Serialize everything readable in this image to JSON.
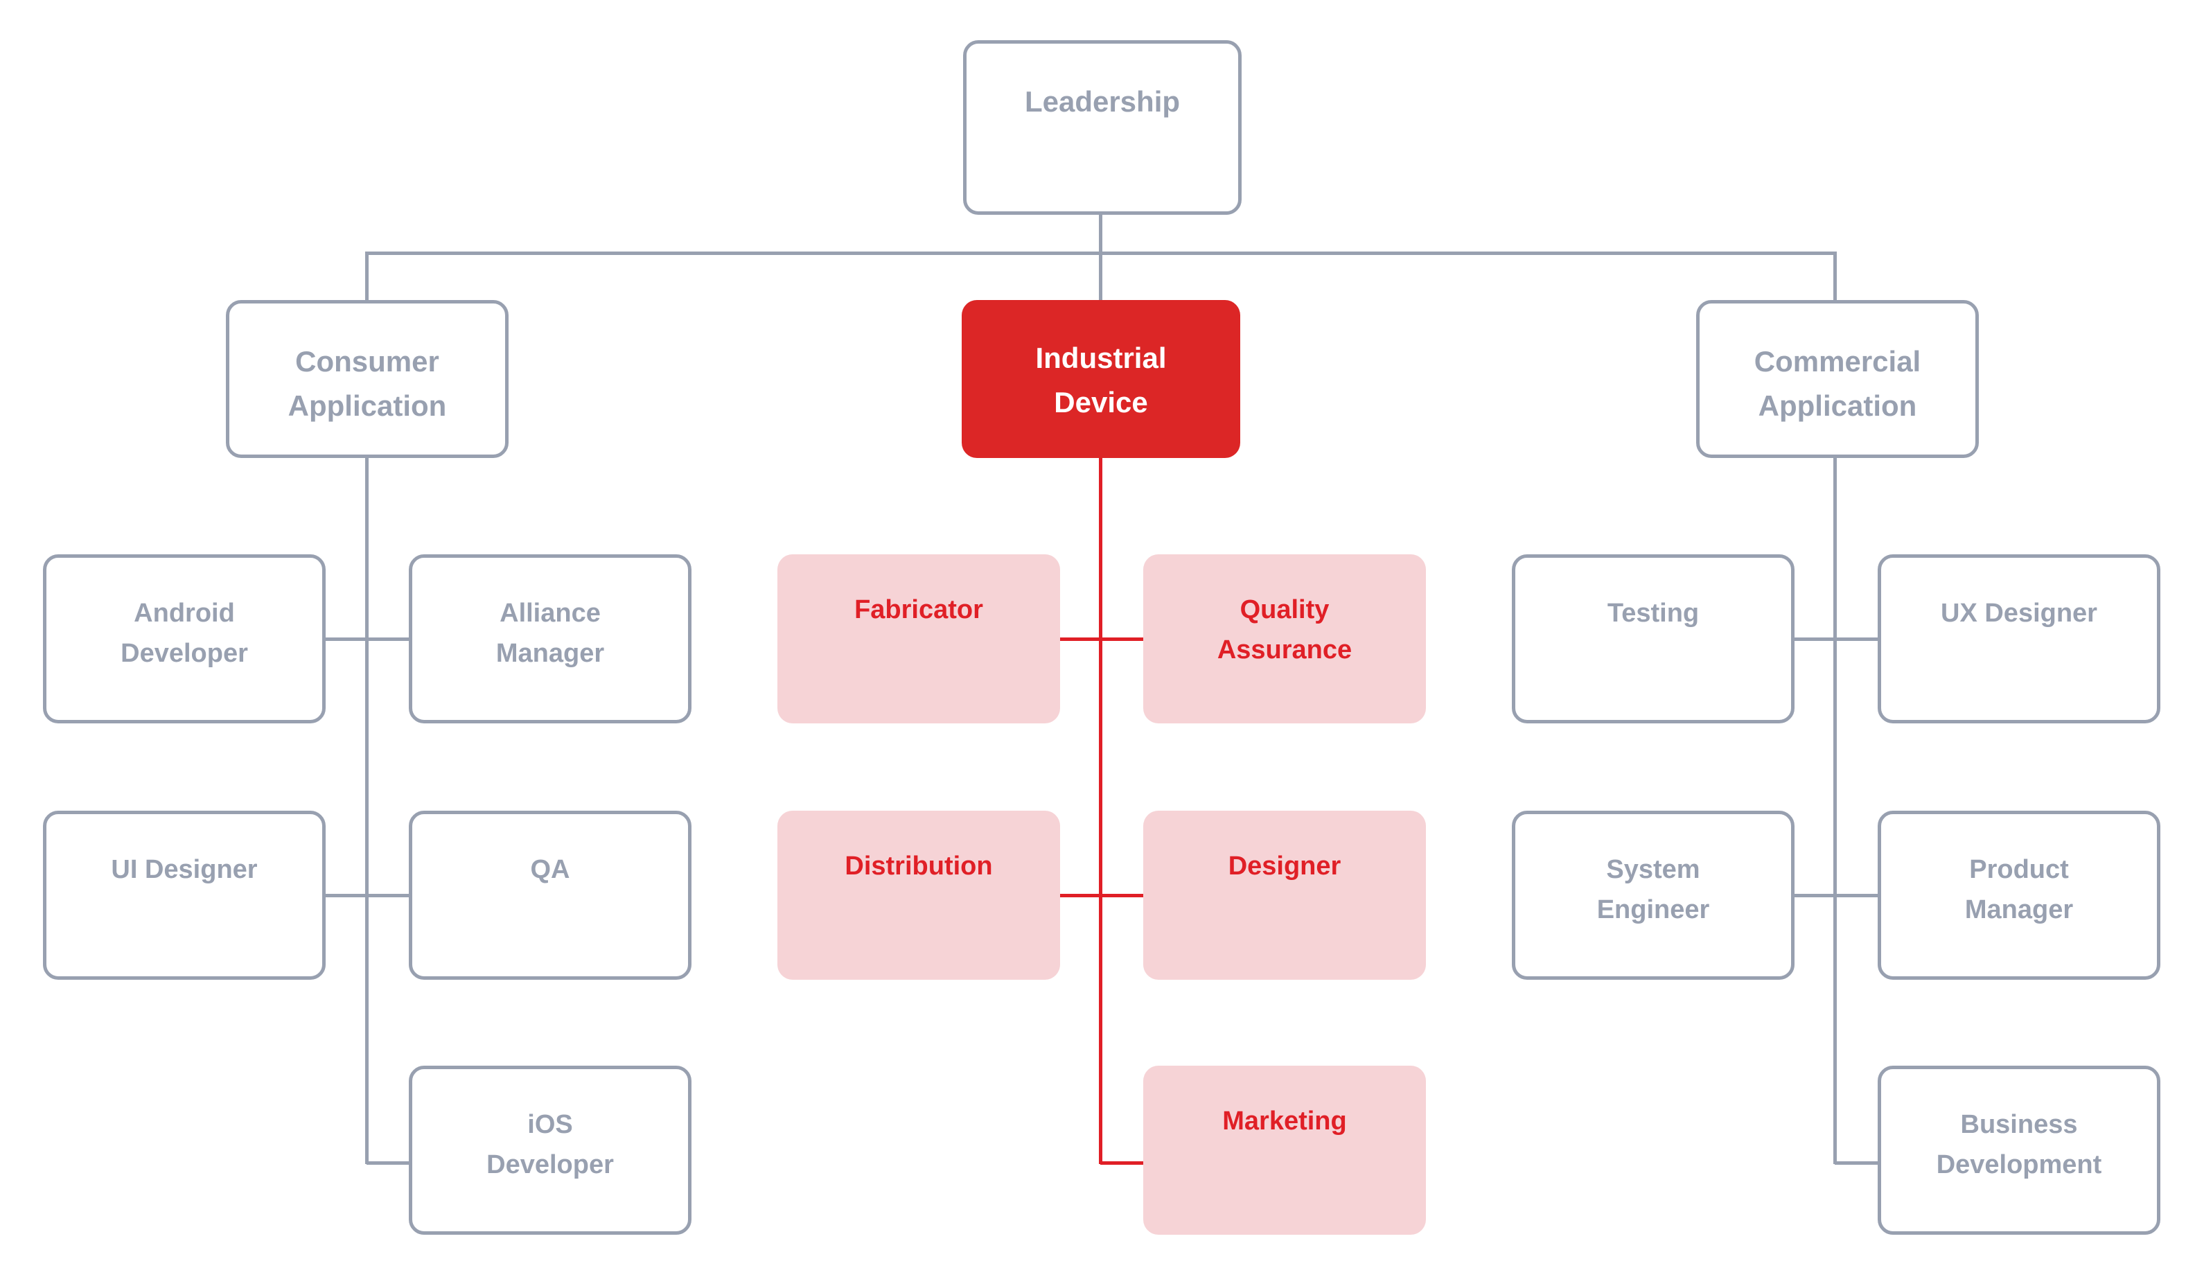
{
  "chart_data": {
    "type": "diagram",
    "subtype": "org-chart",
    "title": "",
    "root": "Leadership",
    "accent_colors": {
      "neutral_line": "#98a0b0",
      "neutral_text": "#98a0b0",
      "highlight_fill": "#dc2626",
      "highlight_text": "#ffffff",
      "highlight_child_fill": "#f6d3d6",
      "highlight_child_text": "#e01f26",
      "background": "#ffffff"
    },
    "nodes": [
      {
        "id": "leadership",
        "label": "Leadership",
        "level": 1,
        "style": "outline"
      },
      {
        "id": "consumer_application",
        "label": "Consumer\nApplication",
        "level": 2,
        "style": "outline"
      },
      {
        "id": "industrial_device",
        "label": "Industrial\nDevice",
        "level": 2,
        "style": "solid"
      },
      {
        "id": "commercial_application",
        "label": "Commercial\nApplication",
        "level": 2,
        "style": "outline"
      },
      {
        "id": "android_developer",
        "label": "Android\nDeveloper",
        "level": 3,
        "style": "outline",
        "parent": "consumer_application"
      },
      {
        "id": "alliance_manager",
        "label": "Alliance\nManager",
        "level": 3,
        "style": "outline",
        "parent": "consumer_application"
      },
      {
        "id": "ui_designer",
        "label": "UI Designer",
        "level": 3,
        "style": "outline",
        "parent": "consumer_application"
      },
      {
        "id": "qa",
        "label": "QA",
        "level": 3,
        "style": "outline",
        "parent": "consumer_application"
      },
      {
        "id": "ios_developer",
        "label": "iOS\nDeveloper",
        "level": 3,
        "style": "outline",
        "parent": "consumer_application"
      },
      {
        "id": "fabricator",
        "label": "Fabricator",
        "level": 3,
        "style": "pink",
        "parent": "industrial_device"
      },
      {
        "id": "quality_assurance",
        "label": "Quality\nAssurance",
        "level": 3,
        "style": "pink",
        "parent": "industrial_device"
      },
      {
        "id": "distribution",
        "label": "Distribution",
        "level": 3,
        "style": "pink",
        "parent": "industrial_device"
      },
      {
        "id": "designer",
        "label": "Designer",
        "level": 3,
        "style": "pink",
        "parent": "industrial_device"
      },
      {
        "id": "marketing",
        "label": "Marketing",
        "level": 3,
        "style": "pink",
        "parent": "industrial_device"
      },
      {
        "id": "testing",
        "label": "Testing",
        "level": 3,
        "style": "outline",
        "parent": "commercial_application"
      },
      {
        "id": "ux_designer",
        "label": "UX Designer",
        "level": 3,
        "style": "outline",
        "parent": "commercial_application"
      },
      {
        "id": "system_engineer",
        "label": "System\nEngineer",
        "level": 3,
        "style": "outline",
        "parent": "commercial_application"
      },
      {
        "id": "product_manager",
        "label": "Product\nManager",
        "level": 3,
        "style": "outline",
        "parent": "commercial_application"
      },
      {
        "id": "business_development",
        "label": "Business\nDevelopment",
        "level": 3,
        "style": "outline",
        "parent": "commercial_application"
      }
    ],
    "edges": [
      {
        "from": "leadership",
        "to": "consumer_application"
      },
      {
        "from": "leadership",
        "to": "industrial_device"
      },
      {
        "from": "leadership",
        "to": "commercial_application"
      },
      {
        "from": "consumer_application",
        "to": "android_developer"
      },
      {
        "from": "consumer_application",
        "to": "alliance_manager"
      },
      {
        "from": "consumer_application",
        "to": "ui_designer"
      },
      {
        "from": "consumer_application",
        "to": "qa"
      },
      {
        "from": "consumer_application",
        "to": "ios_developer"
      },
      {
        "from": "industrial_device",
        "to": "fabricator"
      },
      {
        "from": "industrial_device",
        "to": "quality_assurance"
      },
      {
        "from": "industrial_device",
        "to": "distribution"
      },
      {
        "from": "industrial_device",
        "to": "designer"
      },
      {
        "from": "industrial_device",
        "to": "marketing"
      },
      {
        "from": "commercial_application",
        "to": "testing"
      },
      {
        "from": "commercial_application",
        "to": "ux_designer"
      },
      {
        "from": "commercial_application",
        "to": "system_engineer"
      },
      {
        "from": "commercial_application",
        "to": "product_manager"
      },
      {
        "from": "commercial_application",
        "to": "business_development"
      }
    ]
  },
  "diagram": {
    "leadership": {
      "label": "Leadership"
    },
    "branch_consumer": {
      "label": "Consumer\nApplication",
      "children": {
        "android_developer": {
          "label": "Android\nDeveloper"
        },
        "alliance_manager": {
          "label": "Alliance\nManager"
        },
        "ui_designer": {
          "label": "UI Designer"
        },
        "qa": {
          "label": "QA"
        },
        "ios_developer": {
          "label": "iOS\nDeveloper"
        }
      }
    },
    "branch_industrial": {
      "label": "Industrial\nDevice",
      "children": {
        "fabricator": {
          "label": "Fabricator"
        },
        "quality_assurance": {
          "label": "Quality\nAssurance"
        },
        "distribution": {
          "label": "Distribution"
        },
        "designer": {
          "label": "Designer"
        },
        "marketing": {
          "label": "Marketing"
        }
      }
    },
    "branch_commercial": {
      "label": "Commercial\nApplication",
      "children": {
        "testing": {
          "label": "Testing"
        },
        "ux_designer": {
          "label": "UX Designer"
        },
        "system_engineer": {
          "label": "System\nEngineer"
        },
        "product_manager": {
          "label": "Product\nManager"
        },
        "business_development": {
          "label": "Business\nDevelopment"
        }
      }
    }
  }
}
